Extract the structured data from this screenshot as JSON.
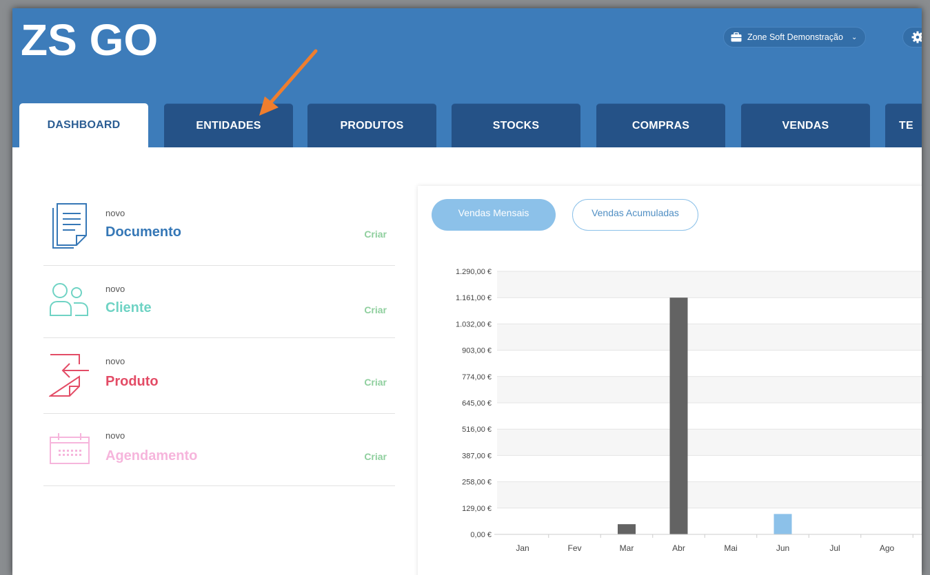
{
  "header": {
    "logo_text": "ZS GO",
    "company_selector": "Zone Soft Demonstração",
    "company_icon": "briefcase-icon",
    "settings_icon": "gear-icon"
  },
  "tabs": [
    {
      "label": "DASHBOARD",
      "active": true
    },
    {
      "label": "ENTIDADES",
      "active": false
    },
    {
      "label": "PRODUTOS",
      "active": false
    },
    {
      "label": "STOCKS",
      "active": false
    },
    {
      "label": "COMPRAS",
      "active": false
    },
    {
      "label": "VENDAS",
      "active": false
    },
    {
      "label": "TE",
      "active": false
    }
  ],
  "quick_actions": [
    {
      "prefix": "novo",
      "title": "Documento",
      "action": "Criar",
      "color": "#3577b6",
      "icon": "document-icon"
    },
    {
      "prefix": "novo",
      "title": "Cliente",
      "action": "Criar",
      "color": "#6fd3c4",
      "icon": "users-icon"
    },
    {
      "prefix": "novo",
      "title": "Produto",
      "action": "Criar",
      "color": "#e34c66",
      "icon": "product-import-icon"
    },
    {
      "prefix": "novo",
      "title": "Agendamento",
      "action": "Criar",
      "color": "#f6b5dc",
      "icon": "calendar-icon"
    }
  ],
  "sales_panel": {
    "tab_monthly": "Vendas Mensais",
    "tab_cumulative": "Vendas Acumuladas",
    "active_tab": "Vendas Mensais"
  },
  "chart_data": {
    "type": "bar",
    "categories": [
      "Jan",
      "Fev",
      "Mar",
      "Abr",
      "Mai",
      "Jun",
      "Jul",
      "Ago"
    ],
    "series": [
      {
        "color": "#636363",
        "values": [
          0,
          0,
          50,
          1161,
          0,
          0,
          0,
          0
        ]
      },
      {
        "color": "#8cc1e9",
        "values": [
          0,
          0,
          0,
          0,
          0,
          100,
          0,
          0
        ]
      }
    ],
    "y_ticks": [
      "0,00 €",
      "129,00 €",
      "258,00 €",
      "387,00 €",
      "516,00 €",
      "645,00 €",
      "774,00 €",
      "903,00 €",
      "1.032,00 €",
      "1.161,00 €",
      "1.290,00 €"
    ],
    "ylim": [
      0,
      1290
    ],
    "title": "",
    "xlabel": "",
    "ylabel": ""
  },
  "colors": {
    "header_bg": "#3d7cba",
    "tab_bg": "#255287",
    "annotation_arrow": "#ef7e2e"
  }
}
